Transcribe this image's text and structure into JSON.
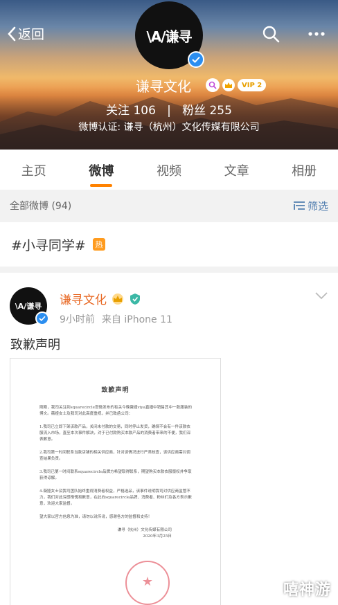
{
  "header": {
    "back_label": "返回",
    "account_name": "谦寻文化",
    "avatar_text": "\\A/谦寻",
    "vip_label": "VIP 2",
    "follow_label": "关注",
    "follow_count": "106",
    "separator": "|",
    "fans_label": "粉丝",
    "fans_count": "255",
    "certification": "微博认证: 谦寻（杭州）文化传媒有限公司"
  },
  "tabs": [
    {
      "label": "主页",
      "active": false
    },
    {
      "label": "微博",
      "active": true
    },
    {
      "label": "视频",
      "active": false
    },
    {
      "label": "文章",
      "active": false
    },
    {
      "label": "相册",
      "active": false
    }
  ],
  "filter": {
    "label": "全部微博 (94)",
    "filter_label": "筛选"
  },
  "topic": {
    "text": "#小寻同学#",
    "badge": "热"
  },
  "post": {
    "author": "谦寻文化",
    "time": "9小时前",
    "source": "来自 iPhone 11",
    "text": "致歉声明",
    "document": {
      "title": "致歉声明",
      "paragraphs": [
        "刚刚，我司关注到squarecircle官微发布的有关今晚薇娅viya直播中销售其中一款服装的博文。薇娅女士及我司对此高度重视，并已致函公司：",
        "1.我司已立即下架该款产品，关闭未付款的交易，同时停止发货，确保不会有一件该款衣服流入市场，直至本次事件解决，对于已付款购买本款产品的消费者带来的不便，我们深表歉意。",
        "2.我司第一时间联系当款店铺的相关供应商，针对该情况进行严肃核查，该供应商需对调查结果负责。",
        "3.我司已第一时间联系squarecircle品牌方希望取得联系，期望购买本款衣服版权并争取获得谅解。",
        "4.薇娅女士及我司团队始终重视消费者权益，严格选品，该事件说明我司对供应商监管不力，我们对此深感惭愧和歉意，在此向squarecircle品牌、消费者、粉丝们及各方表示歉意，欢迎大家监督。",
        "望大家以官方信息为准，请勿以讹传讹，感谢各方的监督和支持！"
      ],
      "signature": "谦寻（杭州）文化传媒有限公司",
      "date": "2020年3月25日"
    }
  },
  "watermark": "嘻神游",
  "colors": {
    "accent": "#ff8200",
    "name_orange": "#e86722",
    "link_blue": "#507daf",
    "verified_blue": "#2b8ef0"
  }
}
